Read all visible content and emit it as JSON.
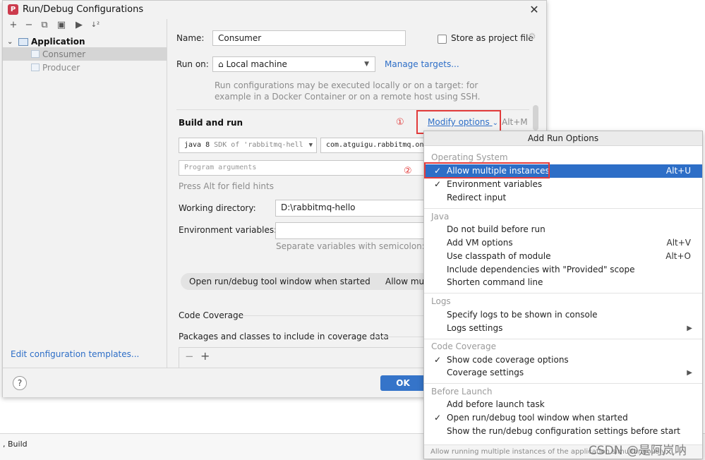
{
  "window": {
    "title": "Run/Debug Configurations",
    "app_icon_letter": "P",
    "close_glyph": "✕"
  },
  "toolbar": {
    "icons": [
      "plus-icon",
      "minus-icon",
      "copy-icon",
      "save-icon",
      "move-to-folder-icon",
      "sort-icon"
    ],
    "glyphs": [
      "+",
      "−",
      "⧉",
      "▣",
      "▶",
      "↓²"
    ]
  },
  "tree": {
    "root_label": "Application",
    "chevron": "⌄",
    "items": [
      {
        "label": "Consumer",
        "selected": true
      },
      {
        "label": "Producer",
        "selected": false
      }
    ],
    "edit_templates": "Edit configuration templates..."
  },
  "form": {
    "name_label": "Name:",
    "name_value": "Consumer",
    "store_label": "Store as project file",
    "run_on_label": "Run on:",
    "run_on_value": "Local machine",
    "run_on_arrow": "▼",
    "run_on_icon_glyph": "⌂",
    "manage_targets": "Manage targets...",
    "run_hint_1": "Run configurations may be executed locally or on a target: for",
    "run_hint_2": "example in a Docker Container or on a remote host using SSH.",
    "build_run": "Build and run",
    "sdk_prefix": "java 8",
    "sdk_value": "SDK of 'rabbitmq-hell",
    "sdk_arrow": "▼",
    "main_class": "com.atguigu.rabbitmq.one.",
    "program_args_placeholder": "Program arguments",
    "field_hint": "Press Alt for field hints",
    "working_dir_label": "Working directory:",
    "working_dir_value": "D:\\rabbitmq-hello",
    "env_label": "Environment variables:",
    "env_hint": "Separate variables with semicolon: VAR",
    "chip1": "Open run/debug tool window when started",
    "chip1_close": "×",
    "chip2": "Allow mul",
    "code_coverage": "Code Coverage",
    "packages": "Packages and classes to include in coverage data",
    "minus_glyph": "−",
    "plus_glyph": "+"
  },
  "footer": {
    "help": "?",
    "ok": "OK"
  },
  "modify": {
    "label": "Modify options",
    "chevron": "⌄",
    "shortcut": "Alt+M",
    "marker1": "①",
    "marker2": "②"
  },
  "popup": {
    "title": "Add Run Options",
    "groups": [
      {
        "name": "Operating System",
        "items": [
          {
            "label": "Allow multiple instances",
            "checked": true,
            "shortcut": "Alt+U",
            "highlight": true
          },
          {
            "label": "Environment variables",
            "checked": true,
            "shortcut": ""
          },
          {
            "label": "Redirect input",
            "checked": false,
            "shortcut": ""
          }
        ]
      },
      {
        "name": "Java",
        "items": [
          {
            "label": "Do not build before run",
            "checked": false,
            "shortcut": ""
          },
          {
            "label": "Add VM options",
            "checked": false,
            "shortcut": "Alt+V"
          },
          {
            "label": "Use classpath of module",
            "checked": false,
            "shortcut": "Alt+O"
          },
          {
            "label": "Include dependencies with \"Provided\" scope",
            "checked": false,
            "shortcut": ""
          },
          {
            "label": "Shorten command line",
            "checked": false,
            "shortcut": ""
          }
        ]
      },
      {
        "name": "Logs",
        "items": [
          {
            "label": "Specify logs to be shown in console",
            "checked": false,
            "shortcut": ""
          },
          {
            "label": "Logs settings",
            "checked": false,
            "shortcut": "",
            "submenu": true
          }
        ]
      },
      {
        "name": "Code Coverage",
        "items": [
          {
            "label": "Show code coverage options",
            "checked": true,
            "shortcut": ""
          },
          {
            "label": "Coverage settings",
            "checked": false,
            "shortcut": "",
            "submenu": true
          }
        ]
      },
      {
        "name": "Before Launch",
        "items": [
          {
            "label": "Add before launch task",
            "checked": false,
            "shortcut": ""
          },
          {
            "label": "Open run/debug tool window when started",
            "checked": true,
            "shortcut": ""
          },
          {
            "label": "Show the run/debug configuration settings before start",
            "checked": false,
            "shortcut": ""
          }
        ]
      }
    ],
    "check_glyph": "✓",
    "submenu_glyph": "▶",
    "status": "Allow running multiple instances of the application simultaneously"
  },
  "background": {
    "bottom_label": ", Build"
  },
  "watermark": "CSDN @是阿岚呐",
  "colors": {
    "accent": "#2d6ec7",
    "highlight_border": "#e23b3b",
    "ok_button": "#3574c9"
  }
}
